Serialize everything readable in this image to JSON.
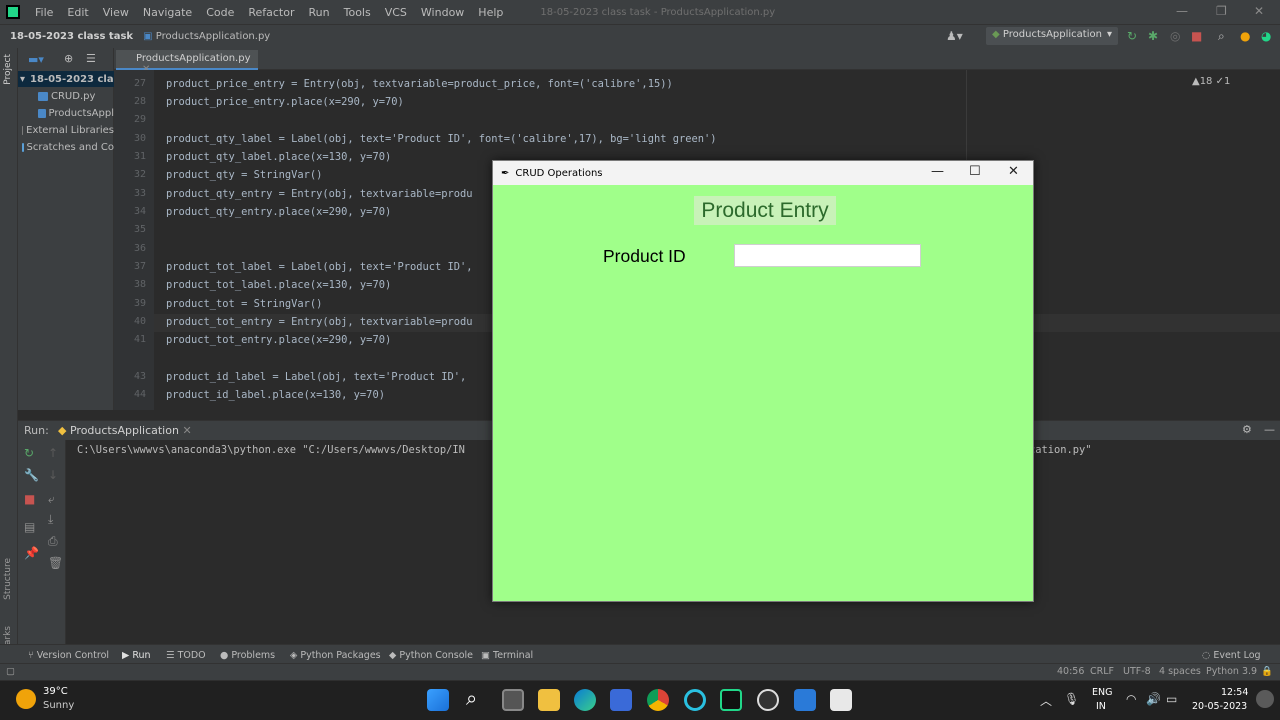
{
  "menubar": {
    "items": [
      "File",
      "Edit",
      "View",
      "Navigate",
      "Code",
      "Refactor",
      "Run",
      "Tools",
      "VCS",
      "Window",
      "Help"
    ],
    "window_title": "18-05-2023 class task - ProductsApplication.py"
  },
  "navbar": {
    "project": "18-05-2023 class task",
    "file": "ProductsApplication.py",
    "run_config": "ProductsApplication"
  },
  "project_panel": {
    "strip_label": "Project",
    "items": [
      "18-05-2023 clas",
      "CRUD.py",
      "ProductsAppl",
      "External Libraries",
      "Scratches and Co"
    ]
  },
  "editor": {
    "tab_label": "ProductsApplication.py",
    "inspections": "▲18 ✓1",
    "line_numbers": [
      "27",
      "28",
      "29",
      "30",
      "31",
      "32",
      "33",
      "34",
      "35",
      "36",
      "37",
      "38",
      "39",
      "40",
      "41",
      "43",
      "44"
    ],
    "lines": [
      "product_price_entry = Entry(obj, textvariable=product_price, font=('calibre',15))",
      "product_price_entry.place(x=290, y=70)",
      "",
      "product_qty_label = Label(obj, text='Product ID', font=('calibre',17), bg='light green')",
      "product_qty_label.place(x=130, y=70)",
      "product_qty = StringVar()",
      "product_qty_entry = Entry(obj, textvariable=produ",
      "product_qty_entry.place(x=290, y=70)",
      "",
      "",
      "product_tot_label = Label(obj, text='Product ID',",
      "product_tot_label.place(x=130, y=70)",
      "product_tot = StringVar()",
      "product_tot_entry = Entry(obj, textvariable=produ",
      "product_tot_entry.place(x=290, y=70)",
      "product_id_label = Label(obj, text='Product ID',",
      "product_id_label.place(x=130, y=70)"
    ]
  },
  "run_panel": {
    "label": "Run:",
    "tab": "ProductsApplication",
    "command_left": "C:\\Users\\wwwvs\\anaconda3\\python.exe \"C:/Users/wwwvs/Desktop/IN",
    "command_right": "cation.py\""
  },
  "tk_window": {
    "title": "CRUD Operations",
    "heading": "Product Entry",
    "label": "Product ID",
    "entry_value": ""
  },
  "tool_tabs": [
    "Version Control",
    "Run",
    "TODO",
    "Problems",
    "Python Packages",
    "Python Console",
    "Terminal"
  ],
  "event_log": "Event Log",
  "side_labels": {
    "structure": "Structure",
    "bookmarks": "Bookmarks"
  },
  "status": {
    "position": "40:56",
    "line_sep": "CRLF",
    "encoding": "UTF-8",
    "indent": "4 spaces",
    "interpreter": "Python 3.9"
  },
  "taskbar": {
    "weather_temp": "39°C",
    "weather_desc": "Sunny",
    "lang": "ENG",
    "region": "IN",
    "time": "12:54",
    "date": "20-05-2023"
  }
}
